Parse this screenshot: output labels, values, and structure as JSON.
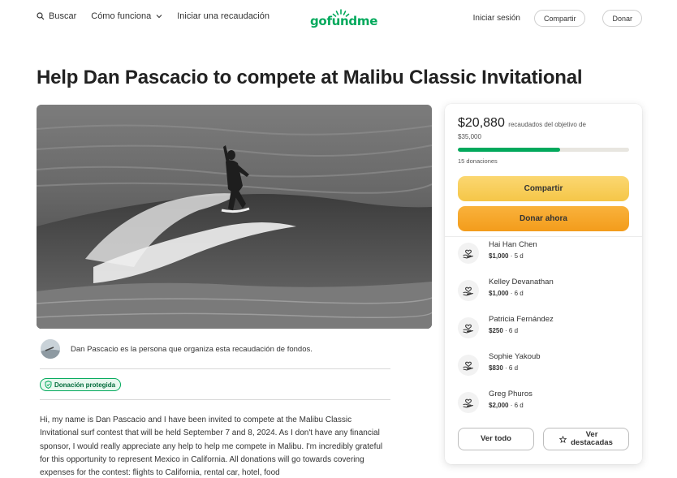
{
  "header": {
    "search_label": "Buscar",
    "how_it_works_label": "Cómo funciona",
    "start_label": "Iniciar una recaudación",
    "logo_text": "gofundme",
    "signin_label": "Iniciar sesión",
    "share_label": "Compartir",
    "donate_label": "Donar"
  },
  "page": {
    "title": "Help Dan Pascacio to compete at Malibu Classic Invitational"
  },
  "organizer": {
    "text": "Dan Pascacio es la persona que organiza esta recaudación de fondos."
  },
  "badge": {
    "label": "Donación protegida"
  },
  "story": {
    "text": "Hi, my name is Dan Pascacio and I have been invited to compete at the Malibu Classic Invitational surf contest that will be held September 7 and 8, 2024. As I don't have any financial sponsor, I would really appreciate any help to help me compete in Malibu. I'm incredibly grateful for this opportunity to represent Mexico in California. All donations will go towards covering expenses for the contest: flights to California, rental car, hotel, food"
  },
  "card": {
    "raised_amount": "$20,880",
    "raised_text": "recaudados del objetivo de",
    "goal": "$35,000",
    "progress_fraction": 0.597,
    "donations_count": "15 donaciones",
    "share_button": "Compartir",
    "donate_button": "Donar ahora",
    "see_all_button": "Ver todo",
    "see_top_line1": "Ver",
    "see_top_line2": "destacadas",
    "donors": [
      {
        "name": "Hai Han Chen",
        "amount": "$1,000",
        "time": " · 5 d"
      },
      {
        "name": "Kelley Devanathan",
        "amount": "$1,000",
        "time": " · 6 d"
      },
      {
        "name": "Patricia Fernández",
        "amount": "$250",
        "time": " · 6 d"
      },
      {
        "name": "Sophie Yakoub",
        "amount": "$830",
        "time": " · 6 d"
      },
      {
        "name": "Greg Phuros",
        "amount": "$2,000",
        "time": " · 6 d"
      }
    ]
  },
  "colors": {
    "brand": "#02a95c",
    "share_button": "#f5c648",
    "donate_button": "#f39c1b"
  }
}
